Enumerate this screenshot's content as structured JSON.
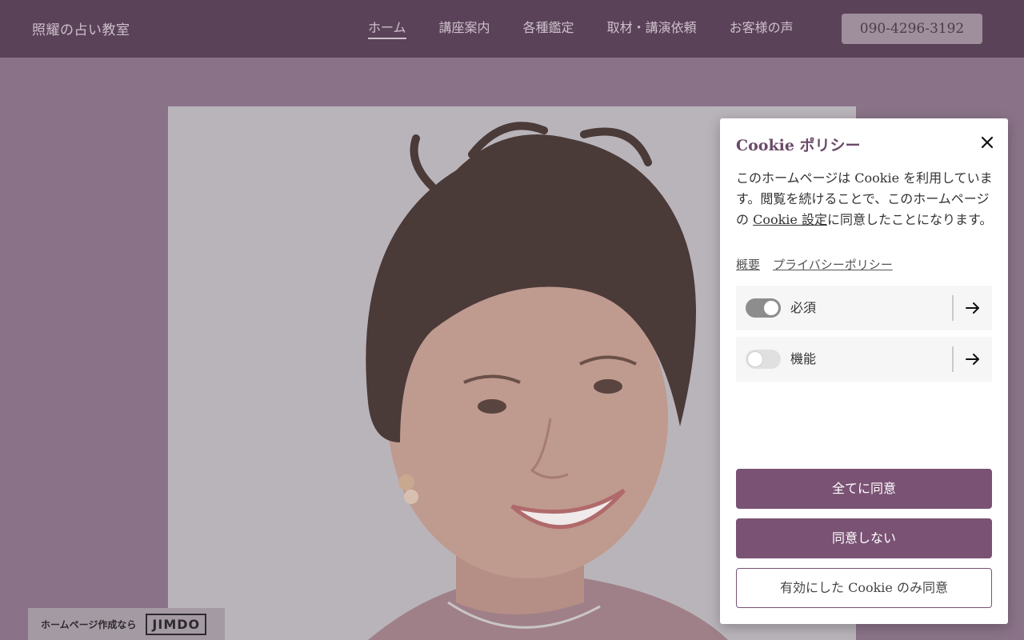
{
  "header": {
    "site_title": "照耀の占い教室",
    "nav": [
      {
        "label": "ホーム",
        "active": true
      },
      {
        "label": "講座案内",
        "active": false
      },
      {
        "label": "各種鑑定",
        "active": false
      },
      {
        "label": "取材・講演依頼",
        "active": false
      },
      {
        "label": "お客様の声",
        "active": false
      }
    ],
    "phone": "090-4296-3192"
  },
  "jimdo": {
    "text": "ホームページ作成なら",
    "logo": "JIMDO"
  },
  "cookie": {
    "title": "Cookie ポリシー",
    "body_before": "このホームページは Cookie を利用しています。閲覧を続けることで、このホームページの ",
    "body_link": "Cookie 設定",
    "body_after": "に同意したことになります。",
    "links": [
      "概要",
      "プライバシーポリシー"
    ],
    "categories": [
      {
        "label": "必須",
        "enabled": true
      },
      {
        "label": "機能",
        "enabled": false
      }
    ],
    "buttons": {
      "accept_all": "全てに同意",
      "decline": "同意しない",
      "accept_selected": "有効にした Cookie のみ同意"
    }
  },
  "colors": {
    "header_bg": "#5a4258",
    "page_bg": "#8a7388",
    "accent": "#7a5274",
    "title": "#6b4a69"
  }
}
